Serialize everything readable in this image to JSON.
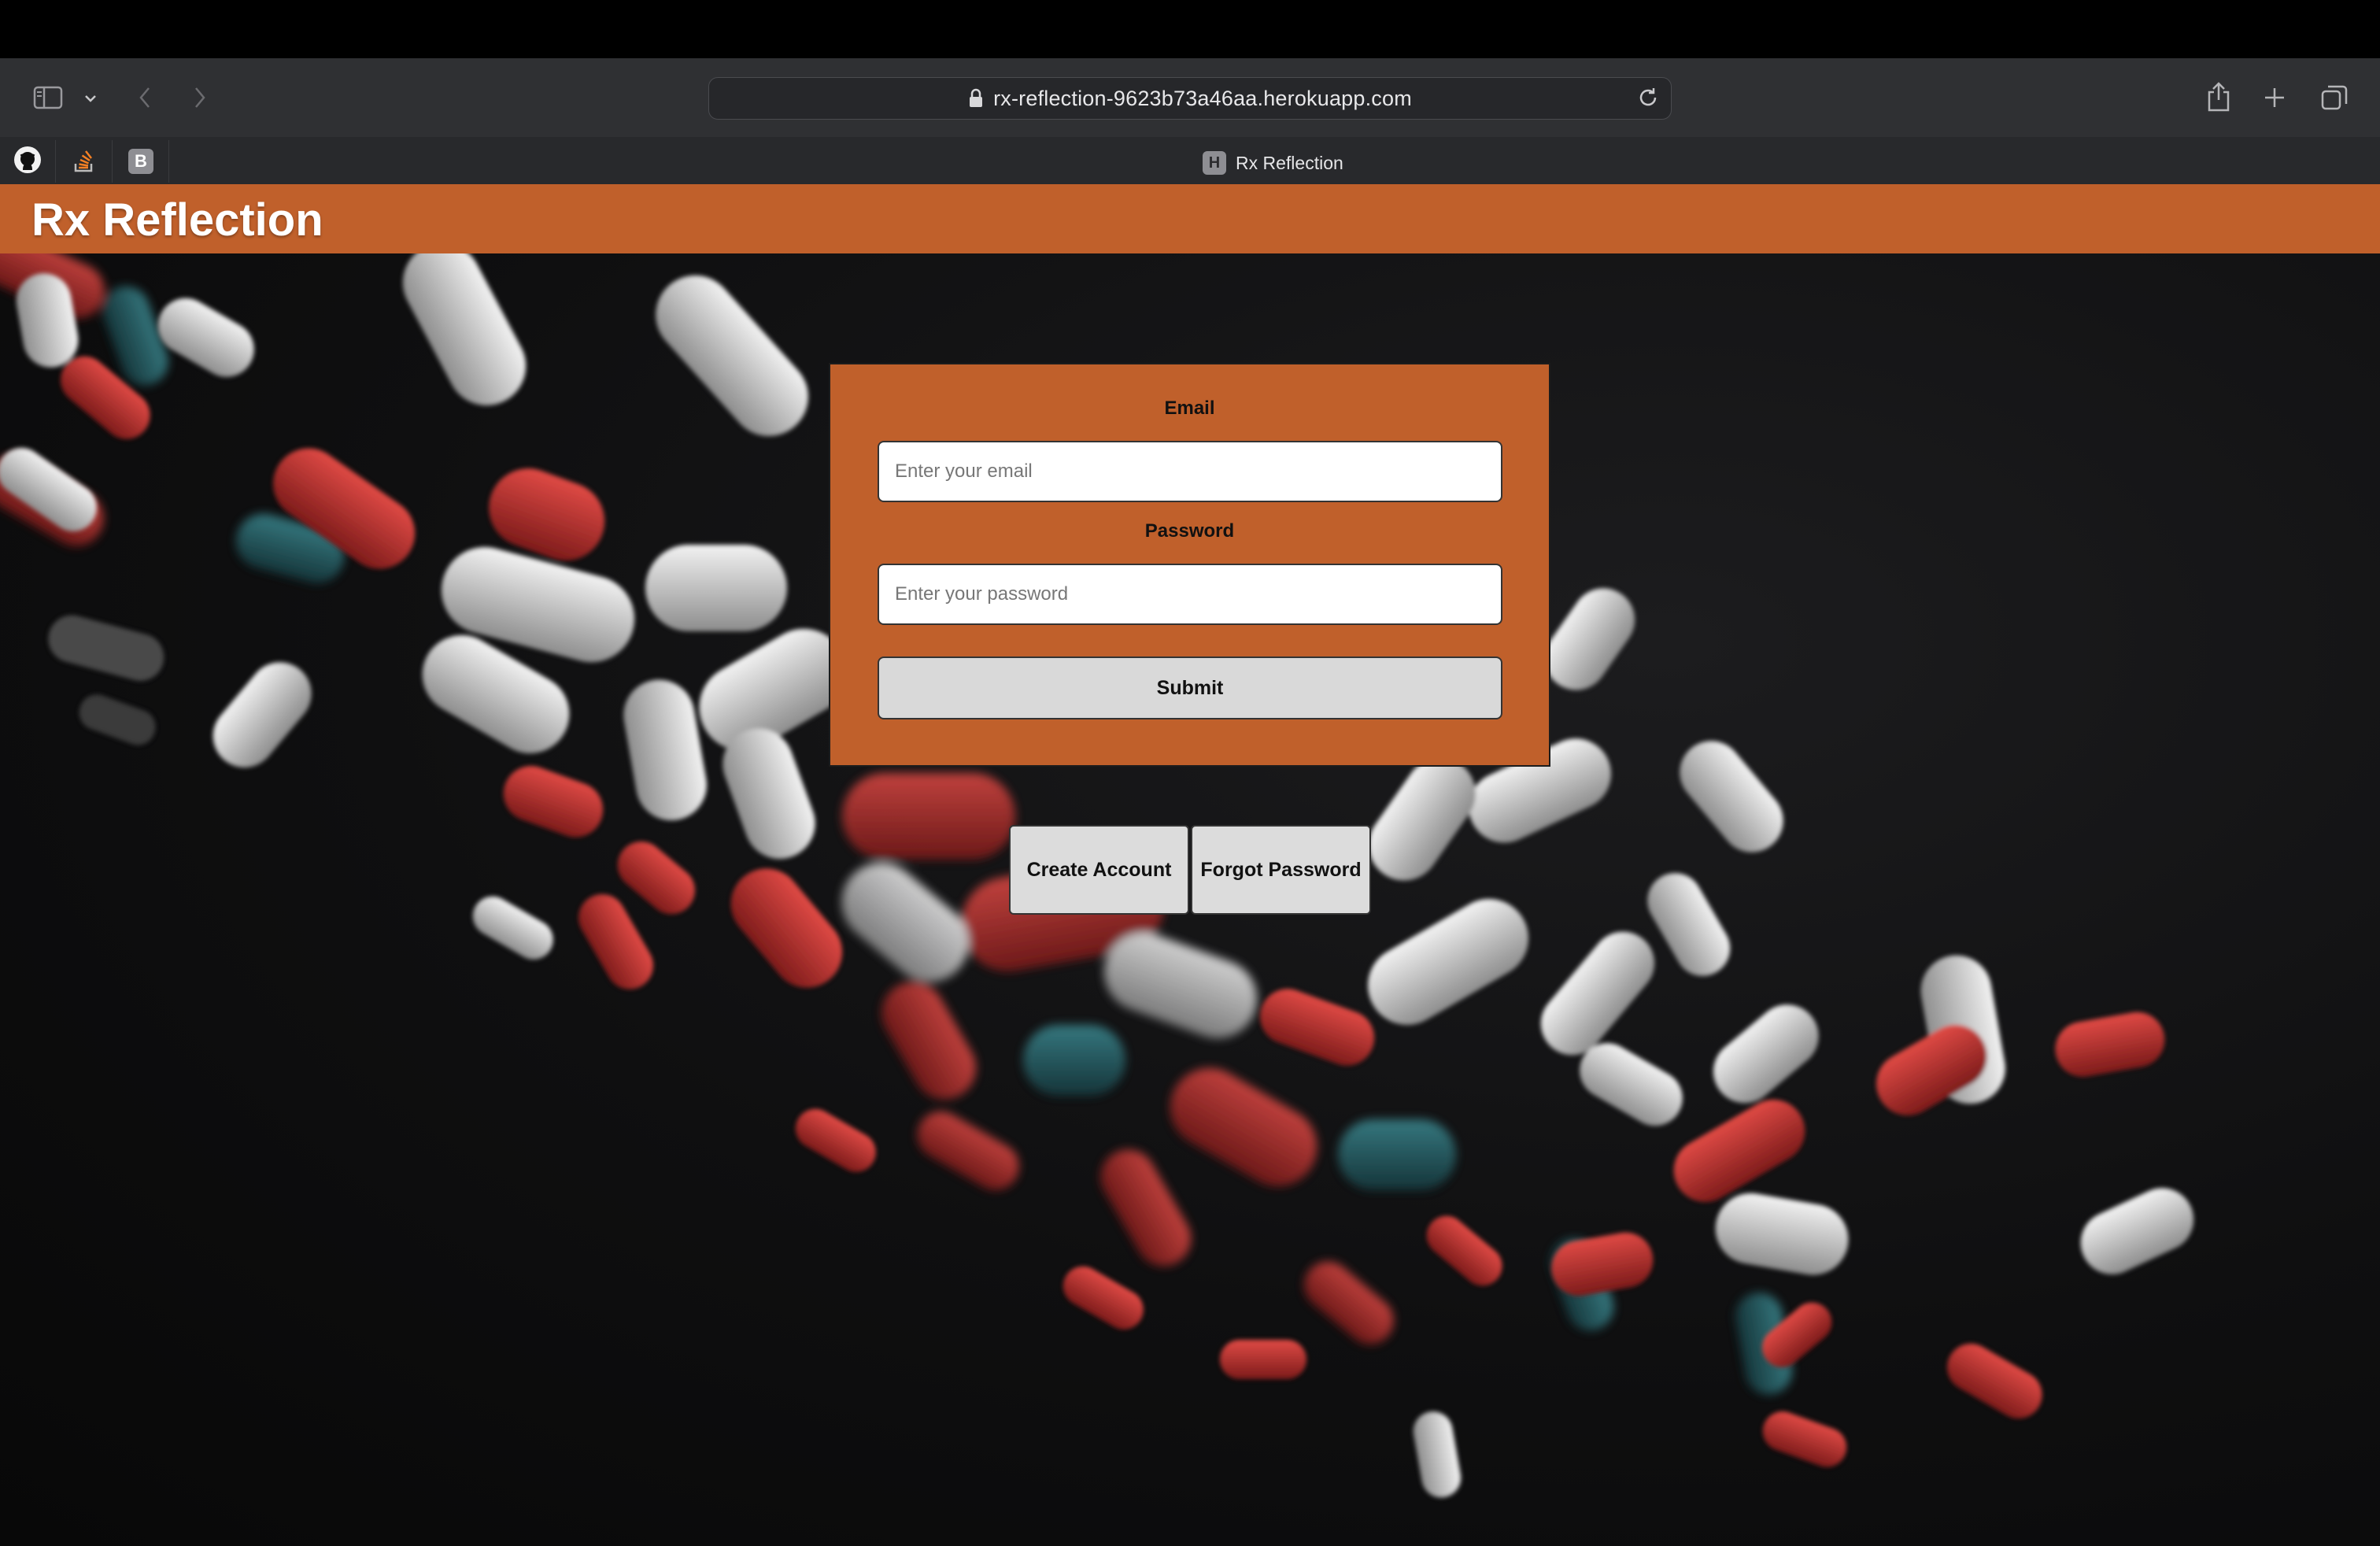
{
  "browser": {
    "url": "rx-reflection-9623b73a46aa.herokuapp.com",
    "tab_title": "Rx Reflection",
    "tab_favicon_letter": "H",
    "pinned_tabs": [
      "github-icon",
      "stackoverflow-icon",
      "B"
    ]
  },
  "app": {
    "title": "Rx Reflection",
    "accent_color": "#c0602b"
  },
  "login": {
    "email_label": "Email",
    "email_placeholder": "Enter your email",
    "email_value": "",
    "password_label": "Password",
    "password_placeholder": "Enter your password",
    "password_value": "",
    "submit_label": "Submit"
  },
  "actions": {
    "create_account_label": "Create Account",
    "forgot_password_label": "Forgot Password"
  }
}
